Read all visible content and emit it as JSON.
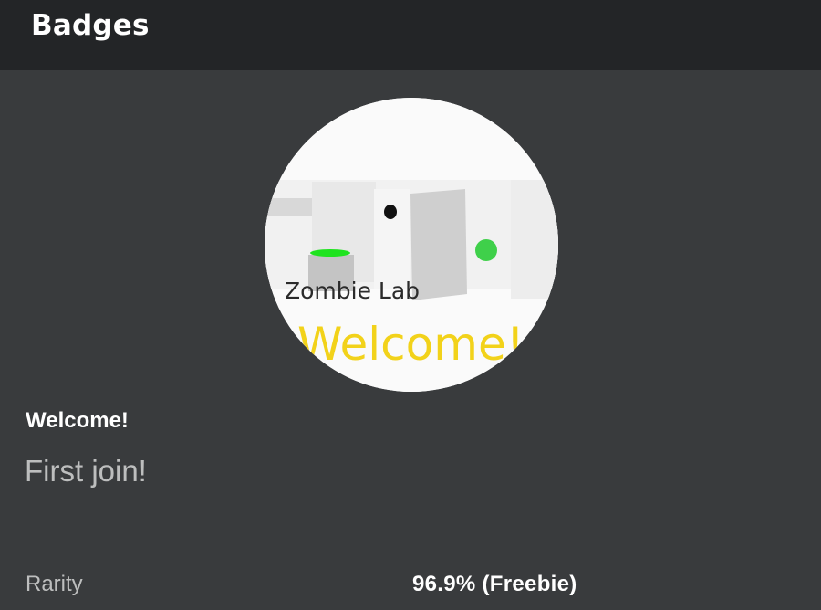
{
  "header": {
    "title": "Badges"
  },
  "badge": {
    "image_caption": "Zombie Lab",
    "image_text": "Welcome!",
    "name": "Welcome!",
    "description": "First join!"
  },
  "stats": {
    "rarity_label": "Rarity",
    "rarity_value": "96.9% (Freebie)"
  },
  "colors": {
    "header_bg": "#232527",
    "page_bg": "#393b3d",
    "image_welcome_text": "#f2d21a",
    "accent_green": "#3fd04a"
  }
}
